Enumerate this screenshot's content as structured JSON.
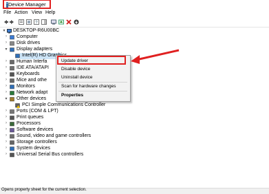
{
  "title": "Device Manager",
  "menu": [
    "File",
    "Action",
    "View",
    "Help"
  ],
  "tree": {
    "root": "DESKTOP-R6U00BC",
    "items": [
      {
        "label": "Computer",
        "icon": "computer-icon",
        "arrow": "right"
      },
      {
        "label": "Disk drives",
        "icon": "disk-icon",
        "arrow": "right"
      },
      {
        "label": "Display adapters",
        "icon": "display-icon",
        "arrow": "down"
      },
      {
        "label": "Intel(R) HD Graphics",
        "icon": "display-icon",
        "arrow": "none",
        "indent": true,
        "selected": true
      },
      {
        "label": "Human Interfa",
        "icon": "hid-icon",
        "arrow": "right"
      },
      {
        "label": "IDE ATA/ATAPI",
        "icon": "ide-icon",
        "arrow": "right"
      },
      {
        "label": "Keyboards",
        "icon": "keyboard-icon",
        "arrow": "right"
      },
      {
        "label": "Mice and othe",
        "icon": "mouse-icon",
        "arrow": "right"
      },
      {
        "label": "Monitors",
        "icon": "monitor-icon",
        "arrow": "right"
      },
      {
        "label": "Network adapt",
        "icon": "network-icon",
        "arrow": "right"
      },
      {
        "label": "Other devices",
        "icon": "other-icon",
        "arrow": "down"
      },
      {
        "label": "PCI Simple Communications Controller",
        "icon": "warning-device-icon",
        "arrow": "none",
        "indent": true
      },
      {
        "label": "Ports (COM & LPT)",
        "icon": "port-icon",
        "arrow": "right"
      },
      {
        "label": "Print queues",
        "icon": "printer-icon",
        "arrow": "right"
      },
      {
        "label": "Processors",
        "icon": "cpu-icon",
        "arrow": "right"
      },
      {
        "label": "Software devices",
        "icon": "software-icon",
        "arrow": "right"
      },
      {
        "label": "Sound, video and game controllers",
        "icon": "sound-icon",
        "arrow": "right"
      },
      {
        "label": "Storage controllers",
        "icon": "storage-icon",
        "arrow": "right"
      },
      {
        "label": "System devices",
        "icon": "system-icon",
        "arrow": "right"
      },
      {
        "label": "Universal Serial Bus controllers",
        "icon": "usb-icon",
        "arrow": "right"
      }
    ]
  },
  "context_menu": {
    "update_driver": "Update driver",
    "disable_device": "Disable device",
    "uninstall_device": "Uninstall device",
    "scan_hardware": "Scan for hardware changes",
    "properties": "Properties"
  },
  "status": "Opens property sheet for the current selection.",
  "colors": {
    "highlight": "#e02020",
    "selection": "#cce4f7"
  }
}
